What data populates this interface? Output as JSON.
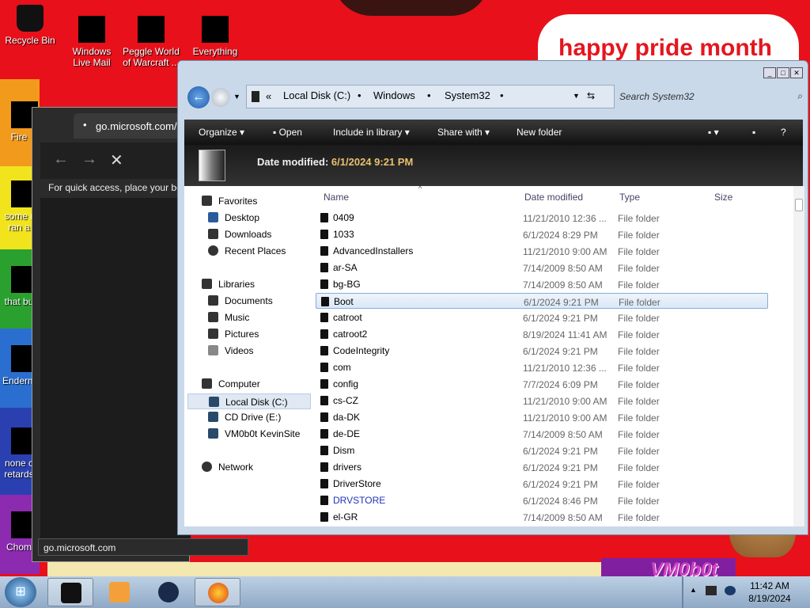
{
  "desktop": {
    "banner": "happy pride month",
    "watermark": "VM0b0t",
    "icons": [
      {
        "label": "Recycle Bin"
      },
      {
        "label": "Windows Live Mail"
      },
      {
        "label": "Peggle World of Warcraft ..."
      },
      {
        "label": "Everything"
      }
    ],
    "partial_labels": [
      "Fire",
      "some r ran a",
      "that bu",
      "Enderm",
      "none c retards",
      "Chom"
    ]
  },
  "browser": {
    "tab_title": "go.microsoft.com/f",
    "quick_access_text": "For quick access, place your bo",
    "status_url": "go.microsoft.com"
  },
  "explorer": {
    "breadcrumb": [
      "Local Disk (C:)",
      "Windows",
      "System32"
    ],
    "search_placeholder": "Search System32",
    "toolbar": {
      "organize": "Organize",
      "open": "Open",
      "include_in_library": "Include in library",
      "share_with": "Share with",
      "new_folder": "New folder"
    },
    "details": {
      "date_modified_label": "Date modified:",
      "date_modified_value": "6/1/2024 9:21 PM"
    },
    "nav": {
      "favorites": "Favorites",
      "desktop": "Desktop",
      "downloads": "Downloads",
      "recent_places": "Recent Places",
      "libraries": "Libraries",
      "documents": "Documents",
      "music": "Music",
      "pictures": "Pictures",
      "videos": "Videos",
      "computer": "Computer",
      "local_disk": "Local Disk (C:)",
      "cd_drive": "CD Drive (E:)",
      "network_drive": "VM0b0t KevinSite",
      "network": "Network"
    },
    "columns": {
      "name": "Name",
      "date_modified": "Date modified",
      "type": "Type",
      "size": "Size"
    },
    "files": [
      {
        "name": "0409",
        "date": "11/21/2010 12:36 ...",
        "type": "File folder"
      },
      {
        "name": "1033",
        "date": "6/1/2024 8:29 PM",
        "type": "File folder"
      },
      {
        "name": "AdvancedInstallers",
        "date": "11/21/2010 9:00 AM",
        "type": "File folder"
      },
      {
        "name": "ar-SA",
        "date": "7/14/2009 8:50 AM",
        "type": "File folder"
      },
      {
        "name": "bg-BG",
        "date": "7/14/2009 8:50 AM",
        "type": "File folder"
      },
      {
        "name": "Boot",
        "date": "6/1/2024 9:21 PM",
        "type": "File folder"
      },
      {
        "name": "catroot",
        "date": "6/1/2024 9:21 PM",
        "type": "File folder"
      },
      {
        "name": "catroot2",
        "date": "8/19/2024 11:41 AM",
        "type": "File folder"
      },
      {
        "name": "CodeIntegrity",
        "date": "6/1/2024 9:21 PM",
        "type": "File folder"
      },
      {
        "name": "com",
        "date": "11/21/2010 12:36 ...",
        "type": "File folder"
      },
      {
        "name": "config",
        "date": "7/7/2024 6:09 PM",
        "type": "File folder"
      },
      {
        "name": "cs-CZ",
        "date": "11/21/2010 9:00 AM",
        "type": "File folder"
      },
      {
        "name": "da-DK",
        "date": "11/21/2010 9:00 AM",
        "type": "File folder"
      },
      {
        "name": "de-DE",
        "date": "7/14/2009 8:50 AM",
        "type": "File folder"
      },
      {
        "name": "Dism",
        "date": "6/1/2024 9:21 PM",
        "type": "File folder"
      },
      {
        "name": "drivers",
        "date": "6/1/2024 9:21 PM",
        "type": "File folder"
      },
      {
        "name": "DriverStore",
        "date": "6/1/2024 9:21 PM",
        "type": "File folder"
      },
      {
        "name": "DRVSTORE",
        "date": "6/1/2024 8:46 PM",
        "type": "File folder"
      },
      {
        "name": "el-GR",
        "date": "7/14/2009 8:50 AM",
        "type": "File folder"
      }
    ],
    "selected_index": 5
  },
  "taskbar": {
    "time": "11:42 AM",
    "date": "8/19/2024"
  },
  "colors": {
    "accent_red": "#e8101a",
    "explorer_frame": "#c9d9ea",
    "selection": "#dae8f7",
    "taskbar": "#a6bdd6"
  }
}
